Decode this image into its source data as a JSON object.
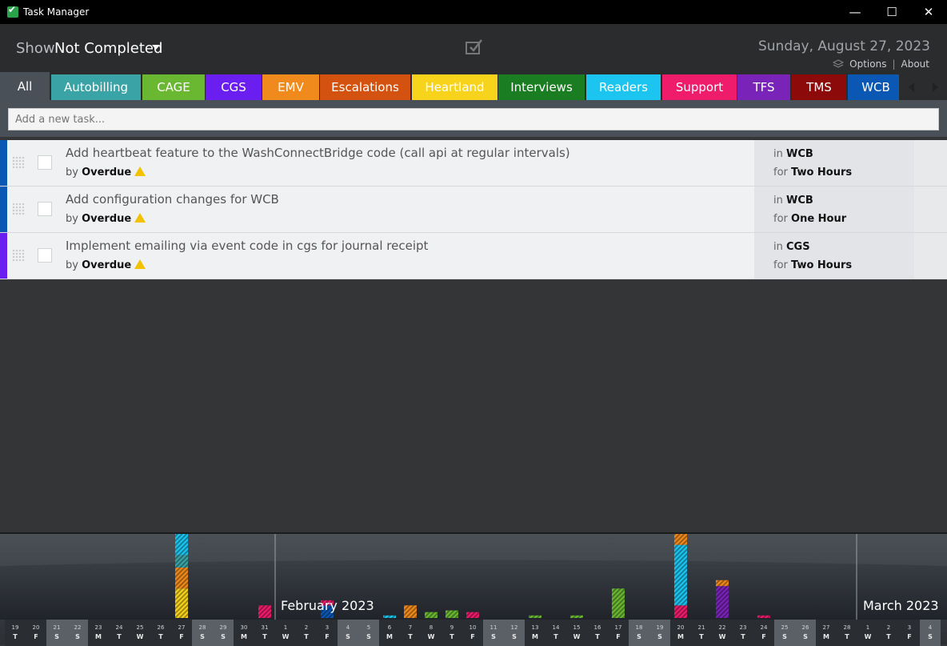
{
  "window": {
    "title": "Task Manager",
    "minimize": "—",
    "maximize": "☐",
    "close": "✕"
  },
  "header": {
    "show_label": "Show",
    "show_value": "Not Completed",
    "date": "Sunday, August 27, 2023",
    "options_link": "Options",
    "separator": "|",
    "about_link": "About"
  },
  "tabs": {
    "all": "All",
    "items": [
      {
        "label": "Autobilling",
        "color": "#3aa3a6"
      },
      {
        "label": "CAGE",
        "color": "#6ab832"
      },
      {
        "label": "CGS",
        "color": "#6a1ef0"
      },
      {
        "label": "EMV",
        "color": "#f08a1c"
      },
      {
        "label": "Escalations",
        "color": "#d4520f"
      },
      {
        "label": "Heartland",
        "color": "#f7d31b"
      },
      {
        "label": "Interviews",
        "color": "#1b7d22"
      },
      {
        "label": "Readers",
        "color": "#1cc5f0"
      },
      {
        "label": "Support",
        "color": "#ee1c6a"
      },
      {
        "label": "TFS",
        "color": "#7a23b8"
      },
      {
        "label": "TMS",
        "color": "#8c0a0a"
      },
      {
        "label": "WCB",
        "color": "#0a58b4"
      }
    ]
  },
  "new_task": {
    "placeholder": "Add a new task..."
  },
  "tasks": [
    {
      "title": "Add heartbeat feature to the WashConnectBridge code (call api at regular intervals)",
      "by_label": "by",
      "due": "Overdue",
      "in_label": "in",
      "category": "WCB",
      "for_label": "for",
      "duration": "Two Hours",
      "color": "#0a58b4"
    },
    {
      "title": "Add configuration changes for WCB",
      "by_label": "by",
      "due": "Overdue",
      "in_label": "in",
      "category": "WCB",
      "for_label": "for",
      "duration": "One Hour",
      "color": "#0a58b4"
    },
    {
      "title": "Implement emailing via event code in cgs for journal receipt",
      "by_label": "by",
      "due": "Overdue",
      "in_label": "in",
      "category": "CGS",
      "for_label": "for",
      "duration": "Two Hours",
      "color": "#6a1ef0"
    }
  ],
  "timeline": {
    "months": [
      "February 2023",
      "March 2023"
    ],
    "days": [
      {
        "n": "19",
        "w": "T"
      },
      {
        "n": "20",
        "w": "F"
      },
      {
        "n": "21",
        "w": "S"
      },
      {
        "n": "22",
        "w": "S"
      },
      {
        "n": "23",
        "w": "M"
      },
      {
        "n": "24",
        "w": "T"
      },
      {
        "n": "25",
        "w": "W"
      },
      {
        "n": "26",
        "w": "T"
      },
      {
        "n": "27",
        "w": "F"
      },
      {
        "n": "28",
        "w": "S"
      },
      {
        "n": "29",
        "w": "S"
      },
      {
        "n": "30",
        "w": "M"
      },
      {
        "n": "31",
        "w": "T"
      },
      {
        "n": "1",
        "w": "W"
      },
      {
        "n": "2",
        "w": "T"
      },
      {
        "n": "3",
        "w": "F"
      },
      {
        "n": "4",
        "w": "S"
      },
      {
        "n": "5",
        "w": "S"
      },
      {
        "n": "6",
        "w": "M"
      },
      {
        "n": "7",
        "w": "T"
      },
      {
        "n": "8",
        "w": "W"
      },
      {
        "n": "9",
        "w": "T"
      },
      {
        "n": "10",
        "w": "F"
      },
      {
        "n": "11",
        "w": "S"
      },
      {
        "n": "12",
        "w": "S"
      },
      {
        "n": "13",
        "w": "M"
      },
      {
        "n": "14",
        "w": "T"
      },
      {
        "n": "15",
        "w": "W"
      },
      {
        "n": "16",
        "w": "T"
      },
      {
        "n": "17",
        "w": "F"
      },
      {
        "n": "18",
        "w": "S"
      },
      {
        "n": "19",
        "w": "S"
      },
      {
        "n": "20",
        "w": "M"
      },
      {
        "n": "21",
        "w": "T"
      },
      {
        "n": "22",
        "w": "W"
      },
      {
        "n": "23",
        "w": "T"
      },
      {
        "n": "24",
        "w": "F"
      },
      {
        "n": "25",
        "w": "S"
      },
      {
        "n": "26",
        "w": "S"
      },
      {
        "n": "27",
        "w": "M"
      },
      {
        "n": "28",
        "w": "T"
      },
      {
        "n": "1",
        "w": "W"
      },
      {
        "n": "2",
        "w": "T"
      },
      {
        "n": "3",
        "w": "F"
      },
      {
        "n": "4",
        "w": "S"
      }
    ],
    "bars": [
      {
        "day": 8,
        "segments": [
          {
            "color": "#f7d31b",
            "h": 0.35
          },
          {
            "color": "#f08a1c",
            "h": 0.25
          },
          {
            "color": "#3aa3a6",
            "h": 0.15
          },
          {
            "color": "#1cc5f0",
            "h": 0.25
          }
        ]
      },
      {
        "day": 12,
        "segments": [
          {
            "color": "#ee1c6a",
            "h": 0.15
          }
        ]
      },
      {
        "day": 15,
        "segments": [
          {
            "color": "#0a58b4",
            "h": 0.15
          },
          {
            "color": "#ee1c6a",
            "h": 0.06
          }
        ]
      },
      {
        "day": 18,
        "segments": [
          {
            "color": "#1cc5f0",
            "h": 0.03
          }
        ]
      },
      {
        "day": 19,
        "segments": [
          {
            "color": "#f08a1c",
            "h": 0.15
          }
        ]
      },
      {
        "day": 20,
        "segments": [
          {
            "color": "#6ab832",
            "h": 0.07
          }
        ]
      },
      {
        "day": 21,
        "segments": [
          {
            "color": "#6ab832",
            "h": 0.09
          }
        ]
      },
      {
        "day": 22,
        "segments": [
          {
            "color": "#ee1c6a",
            "h": 0.07
          }
        ]
      },
      {
        "day": 25,
        "segments": [
          {
            "color": "#6ab832",
            "h": 0.03
          }
        ]
      },
      {
        "day": 27,
        "segments": [
          {
            "color": "#6ab832",
            "h": 0.03
          }
        ]
      },
      {
        "day": 29,
        "segments": [
          {
            "color": "#6ab832",
            "h": 0.35
          }
        ]
      },
      {
        "day": 32,
        "segments": [
          {
            "color": "#ee1c6a",
            "h": 0.15
          },
          {
            "color": "#1cc5f0",
            "h": 0.72
          },
          {
            "color": "#f08a1c",
            "h": 0.13
          }
        ]
      },
      {
        "day": 34,
        "segments": [
          {
            "color": "#7a23b8",
            "h": 0.38
          },
          {
            "color": "#f08a1c",
            "h": 0.07
          }
        ]
      },
      {
        "day": 36,
        "segments": [
          {
            "color": "#ee1c6a",
            "h": 0.03
          }
        ]
      }
    ]
  }
}
